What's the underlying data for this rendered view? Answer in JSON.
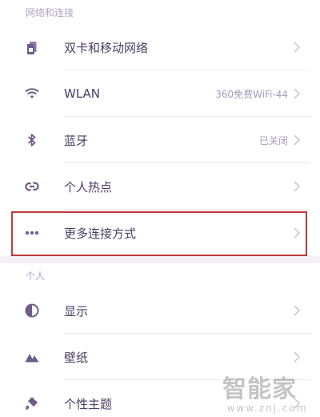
{
  "sections": {
    "network": {
      "header": "网络和连接",
      "items": [
        {
          "label": "双卡和移动网络",
          "value": "",
          "icon": "sim-card-icon"
        },
        {
          "label": "WLAN",
          "value": "360免费WiFi-44",
          "icon": "wifi-icon"
        },
        {
          "label": "蓝牙",
          "value": "已关闭",
          "icon": "bluetooth-icon"
        },
        {
          "label": "个人热点",
          "value": "",
          "icon": "hotspot-icon"
        },
        {
          "label": "更多连接方式",
          "value": "",
          "icon": "more-dots-icon"
        }
      ]
    },
    "personal": {
      "header": "个人",
      "items": [
        {
          "label": "显示",
          "value": "",
          "icon": "display-icon"
        },
        {
          "label": "壁纸",
          "value": "",
          "icon": "wallpaper-icon"
        },
        {
          "label": "个性主题",
          "value": "",
          "icon": "theme-icon"
        }
      ]
    }
  },
  "watermark": {
    "logo": "智能家",
    "url": "www.znj.com"
  },
  "colors": {
    "icon": "#6e5c8a",
    "text": "#4a3d63",
    "secondary": "#a89cb8",
    "highlight": "#c0393b"
  }
}
